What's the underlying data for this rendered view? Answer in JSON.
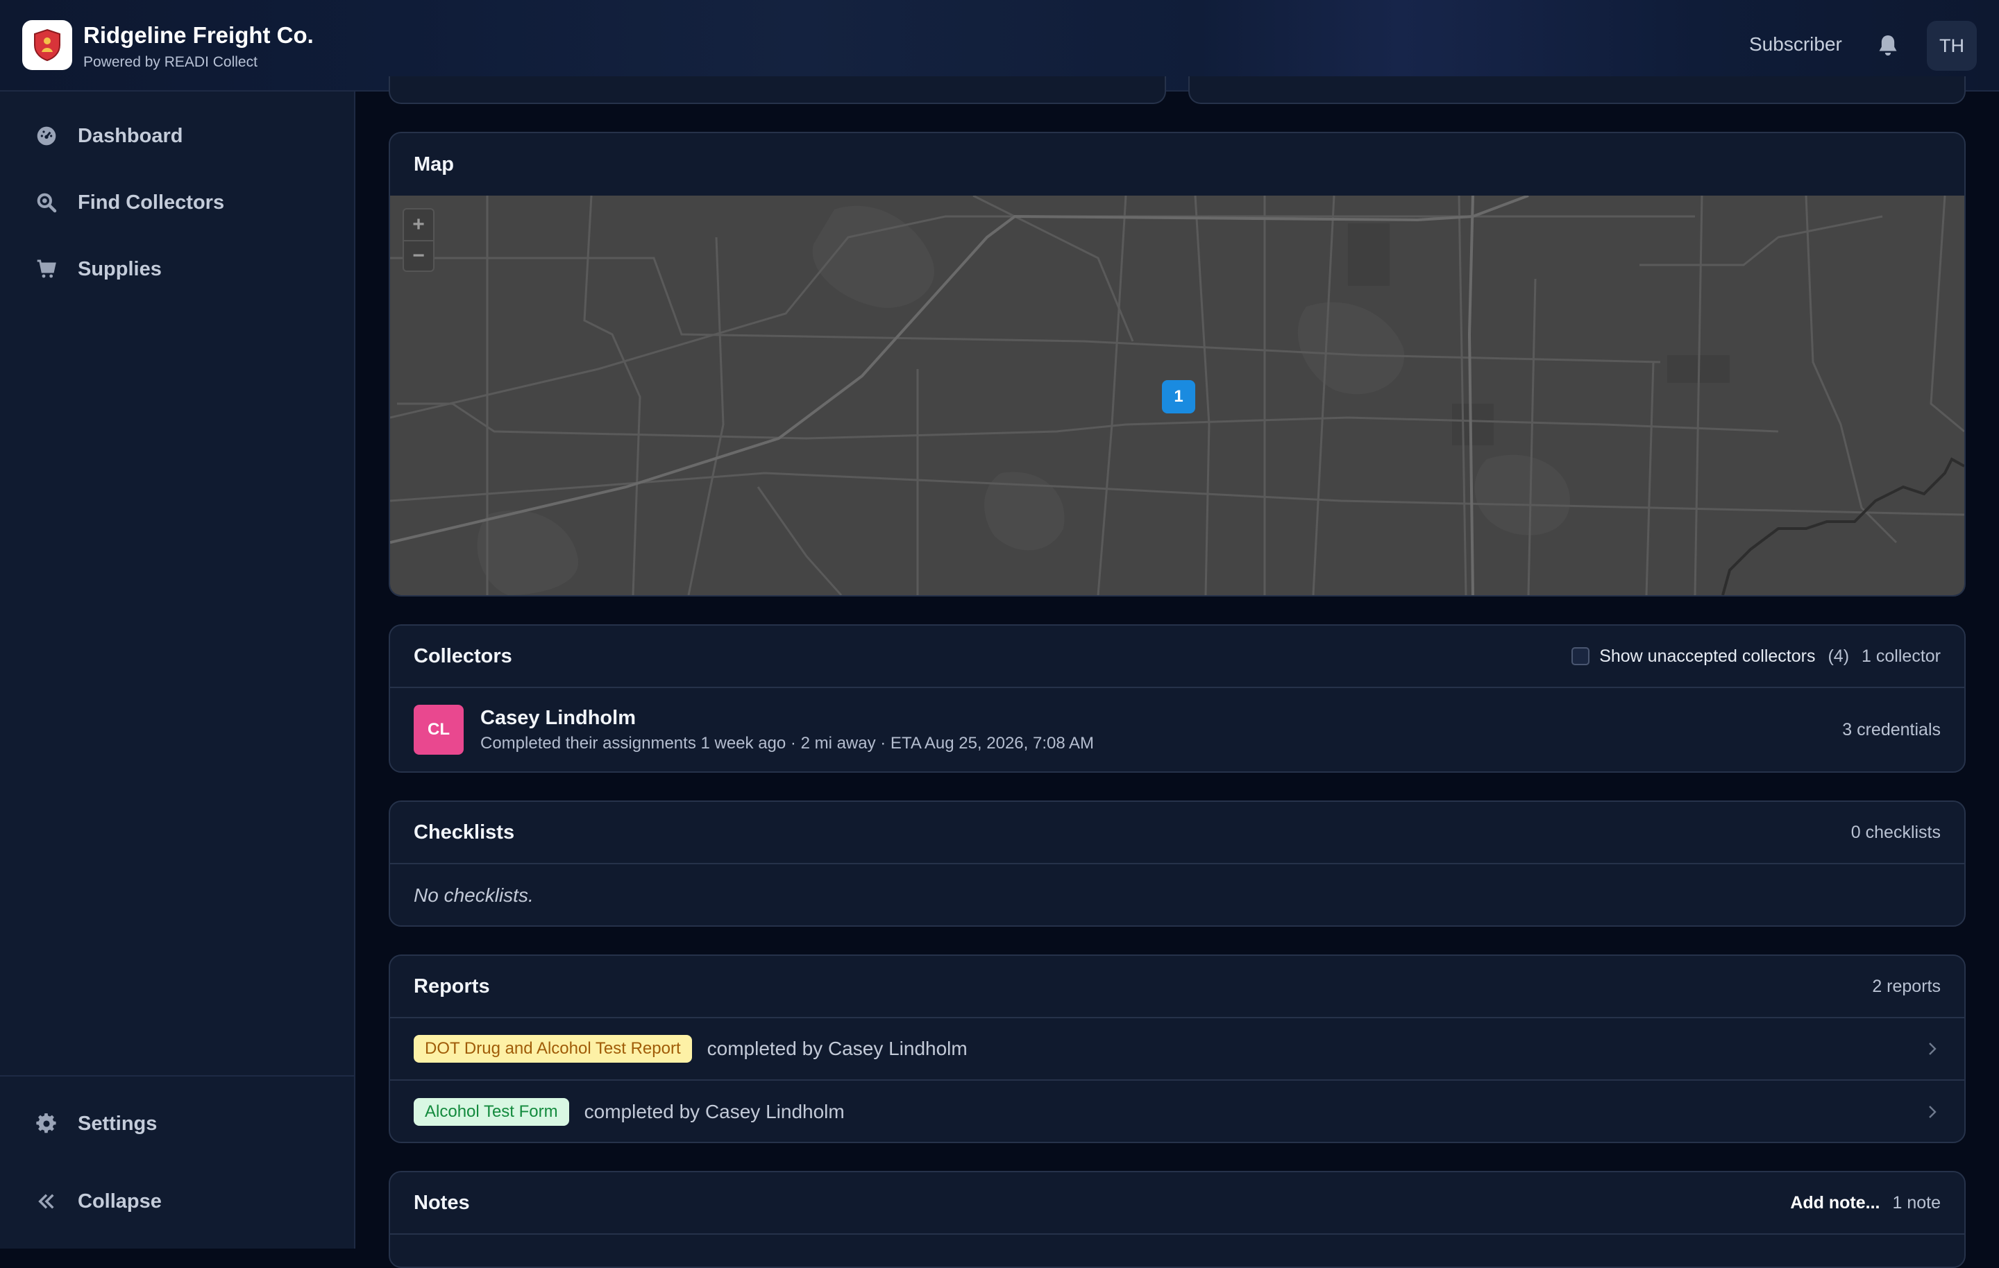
{
  "header": {
    "company": "Ridgeline Freight Co.",
    "powered_by": "Powered by READI Collect",
    "role": "Subscriber",
    "user_initials": "TH"
  },
  "sidebar": {
    "items": [
      {
        "label": "Dashboard",
        "icon": "dashboard-gauge-icon"
      },
      {
        "label": "Find Collectors",
        "icon": "search-icon"
      },
      {
        "label": "Supplies",
        "icon": "cart-icon"
      }
    ],
    "footer": [
      {
        "label": "Settings",
        "icon": "gear-icon"
      },
      {
        "label": "Collapse",
        "icon": "double-chevron-left-icon"
      }
    ]
  },
  "map": {
    "title": "Map",
    "zoom_in": "+",
    "zoom_out": "−",
    "cluster_count": "1"
  },
  "collectors": {
    "title": "Collectors",
    "show_unaccepted_label": "Show unaccepted collectors",
    "unaccepted_count": "(4)",
    "count_label": "1 collector",
    "items": [
      {
        "initials": "CL",
        "name": "Casey Lindholm",
        "meta": "Completed their assignments 1 week ago · 2 mi away · ETA Aug 25, 2026, 7:08 AM",
        "credentials": "3 credentials"
      }
    ]
  },
  "checklists": {
    "title": "Checklists",
    "count_label": "0 checklists",
    "empty": "No checklists."
  },
  "reports": {
    "title": "Reports",
    "count_label": "2 reports",
    "items": [
      {
        "badge": "DOT Drug and Alcohol Test Report",
        "text": "completed by Casey Lindholm",
        "badge_color": "#fdf1a6"
      },
      {
        "badge": "Alcohol Test Form",
        "text": "completed by Casey Lindholm",
        "badge_color": "#d9f7e3"
      }
    ]
  },
  "notes": {
    "title": "Notes",
    "add_label": "Add note...",
    "count_label": "1 note"
  },
  "colors": {
    "background": "#050b1a",
    "card": "#101a2e",
    "accent_marker": "#1a8be0",
    "avatar_pink": "#e9488f"
  }
}
